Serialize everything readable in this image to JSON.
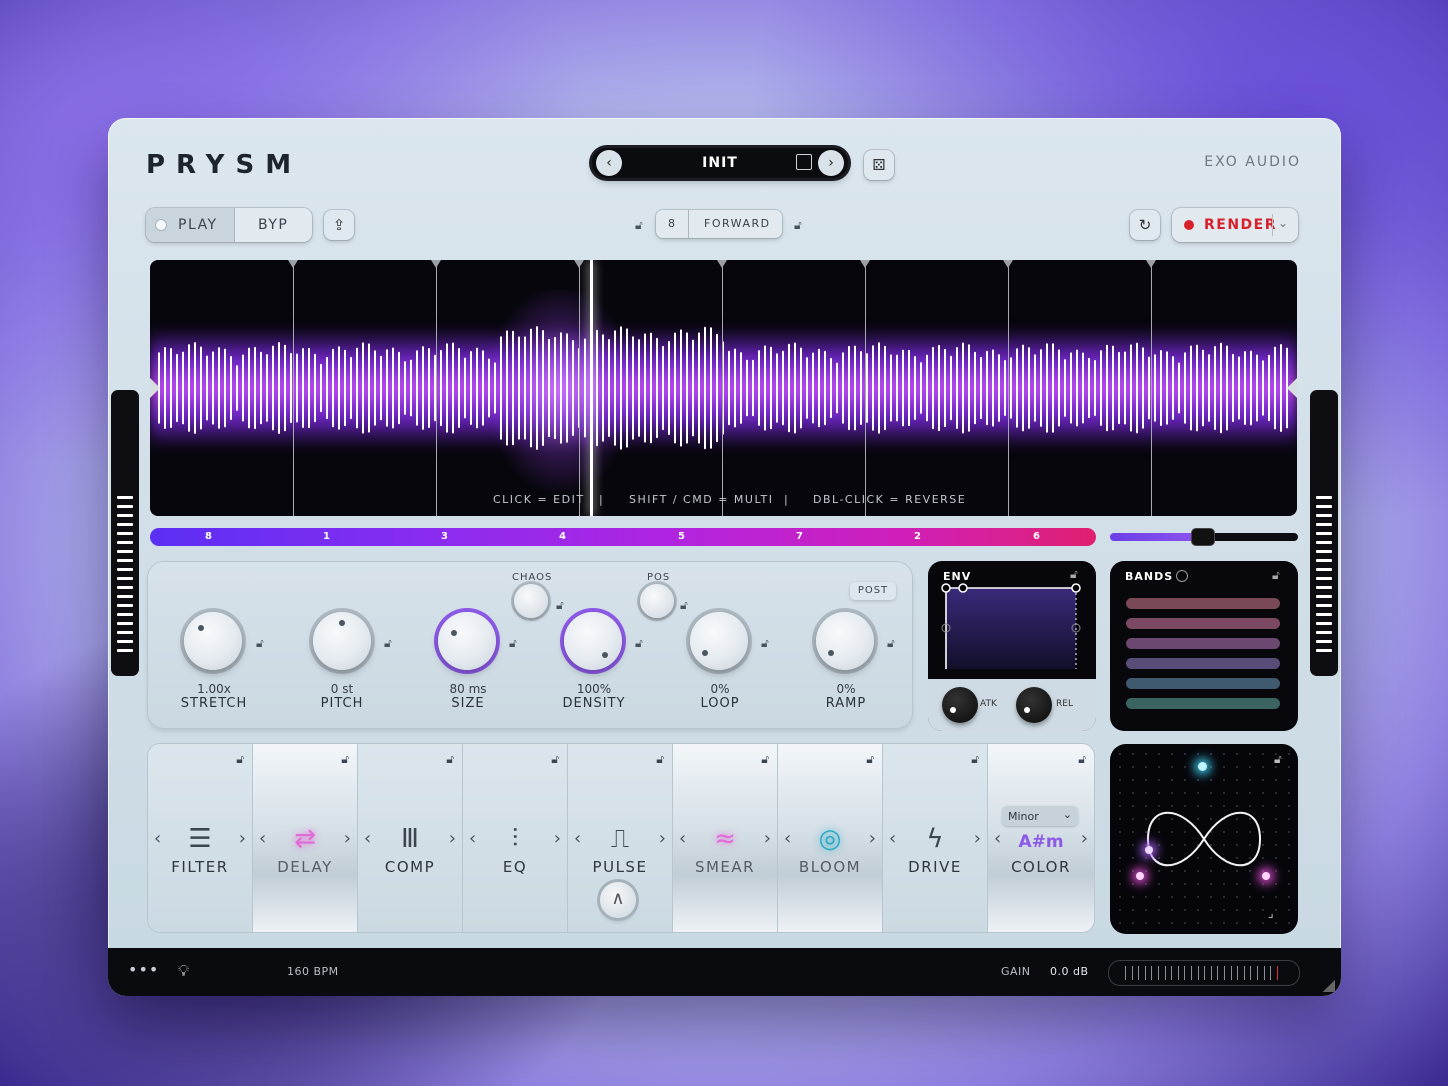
{
  "app": {
    "logo": "PRYSM",
    "brand": "EXO AUDIO"
  },
  "preset": {
    "name": "INIT"
  },
  "transport": {
    "play_label": "PLAY",
    "bypass_label": "BYP",
    "render_label": "RENDER"
  },
  "sequencer": {
    "steps": "8",
    "direction": "FORWARD"
  },
  "hints": {
    "click": "CLICK = EDIT",
    "sep": "|",
    "shift": "SHIFT / CMD = MULTI",
    "dbl": "DBL-CLICK = REVERSE"
  },
  "slice_strip": [
    "8",
    "1",
    "3",
    "4",
    "5",
    "7",
    "2",
    "6"
  ],
  "knobs": [
    {
      "value": "1.00x",
      "label": "STRETCH"
    },
    {
      "value": "0 st",
      "label": "PITCH"
    },
    {
      "value": "80 ms",
      "label": "SIZE"
    },
    {
      "value": "100%",
      "label": "DENSITY"
    },
    {
      "value": "0%",
      "label": "LOOP"
    },
    {
      "value": "0%",
      "label": "RAMP"
    }
  ],
  "mini_knobs": {
    "chaos": "CHAOS",
    "pos": "POS",
    "post": "POST"
  },
  "env": {
    "title": "ENV",
    "atk": "ATK",
    "rel": "REL"
  },
  "bands": {
    "title": "BANDS",
    "colors": [
      "#7a4956",
      "#7b4a62",
      "#6a4870",
      "#574d78",
      "#3f5a6e",
      "#3b6460"
    ]
  },
  "effects": [
    {
      "label": "FILTER",
      "icon": "filter-icon",
      "active": false
    },
    {
      "label": "DELAY",
      "icon": "delay-icon",
      "active": true
    },
    {
      "label": "COMP",
      "icon": "comp-icon",
      "active": false
    },
    {
      "label": "EQ",
      "icon": "eq-icon",
      "active": false
    },
    {
      "label": "PULSE",
      "icon": "pulse-icon",
      "active": false
    },
    {
      "label": "SMEAR",
      "icon": "smear-icon",
      "active": true
    },
    {
      "label": "BLOOM",
      "icon": "bloom-icon",
      "active": true
    },
    {
      "label": "DRIVE",
      "icon": "drive-icon",
      "active": false
    },
    {
      "label": "COLOR",
      "icon": "color-icon",
      "active": true
    }
  ],
  "color_fx": {
    "scale": "Minor",
    "key": "A#m"
  },
  "footer": {
    "bpm": "160 BPM",
    "gain_label": "GAIN",
    "gain_value": "0.0 dB"
  },
  "colors": {
    "accent": "#8d5ae8",
    "render": "#d8202a",
    "pink": "#e06ad6",
    "cyan": "#27a9c6"
  }
}
